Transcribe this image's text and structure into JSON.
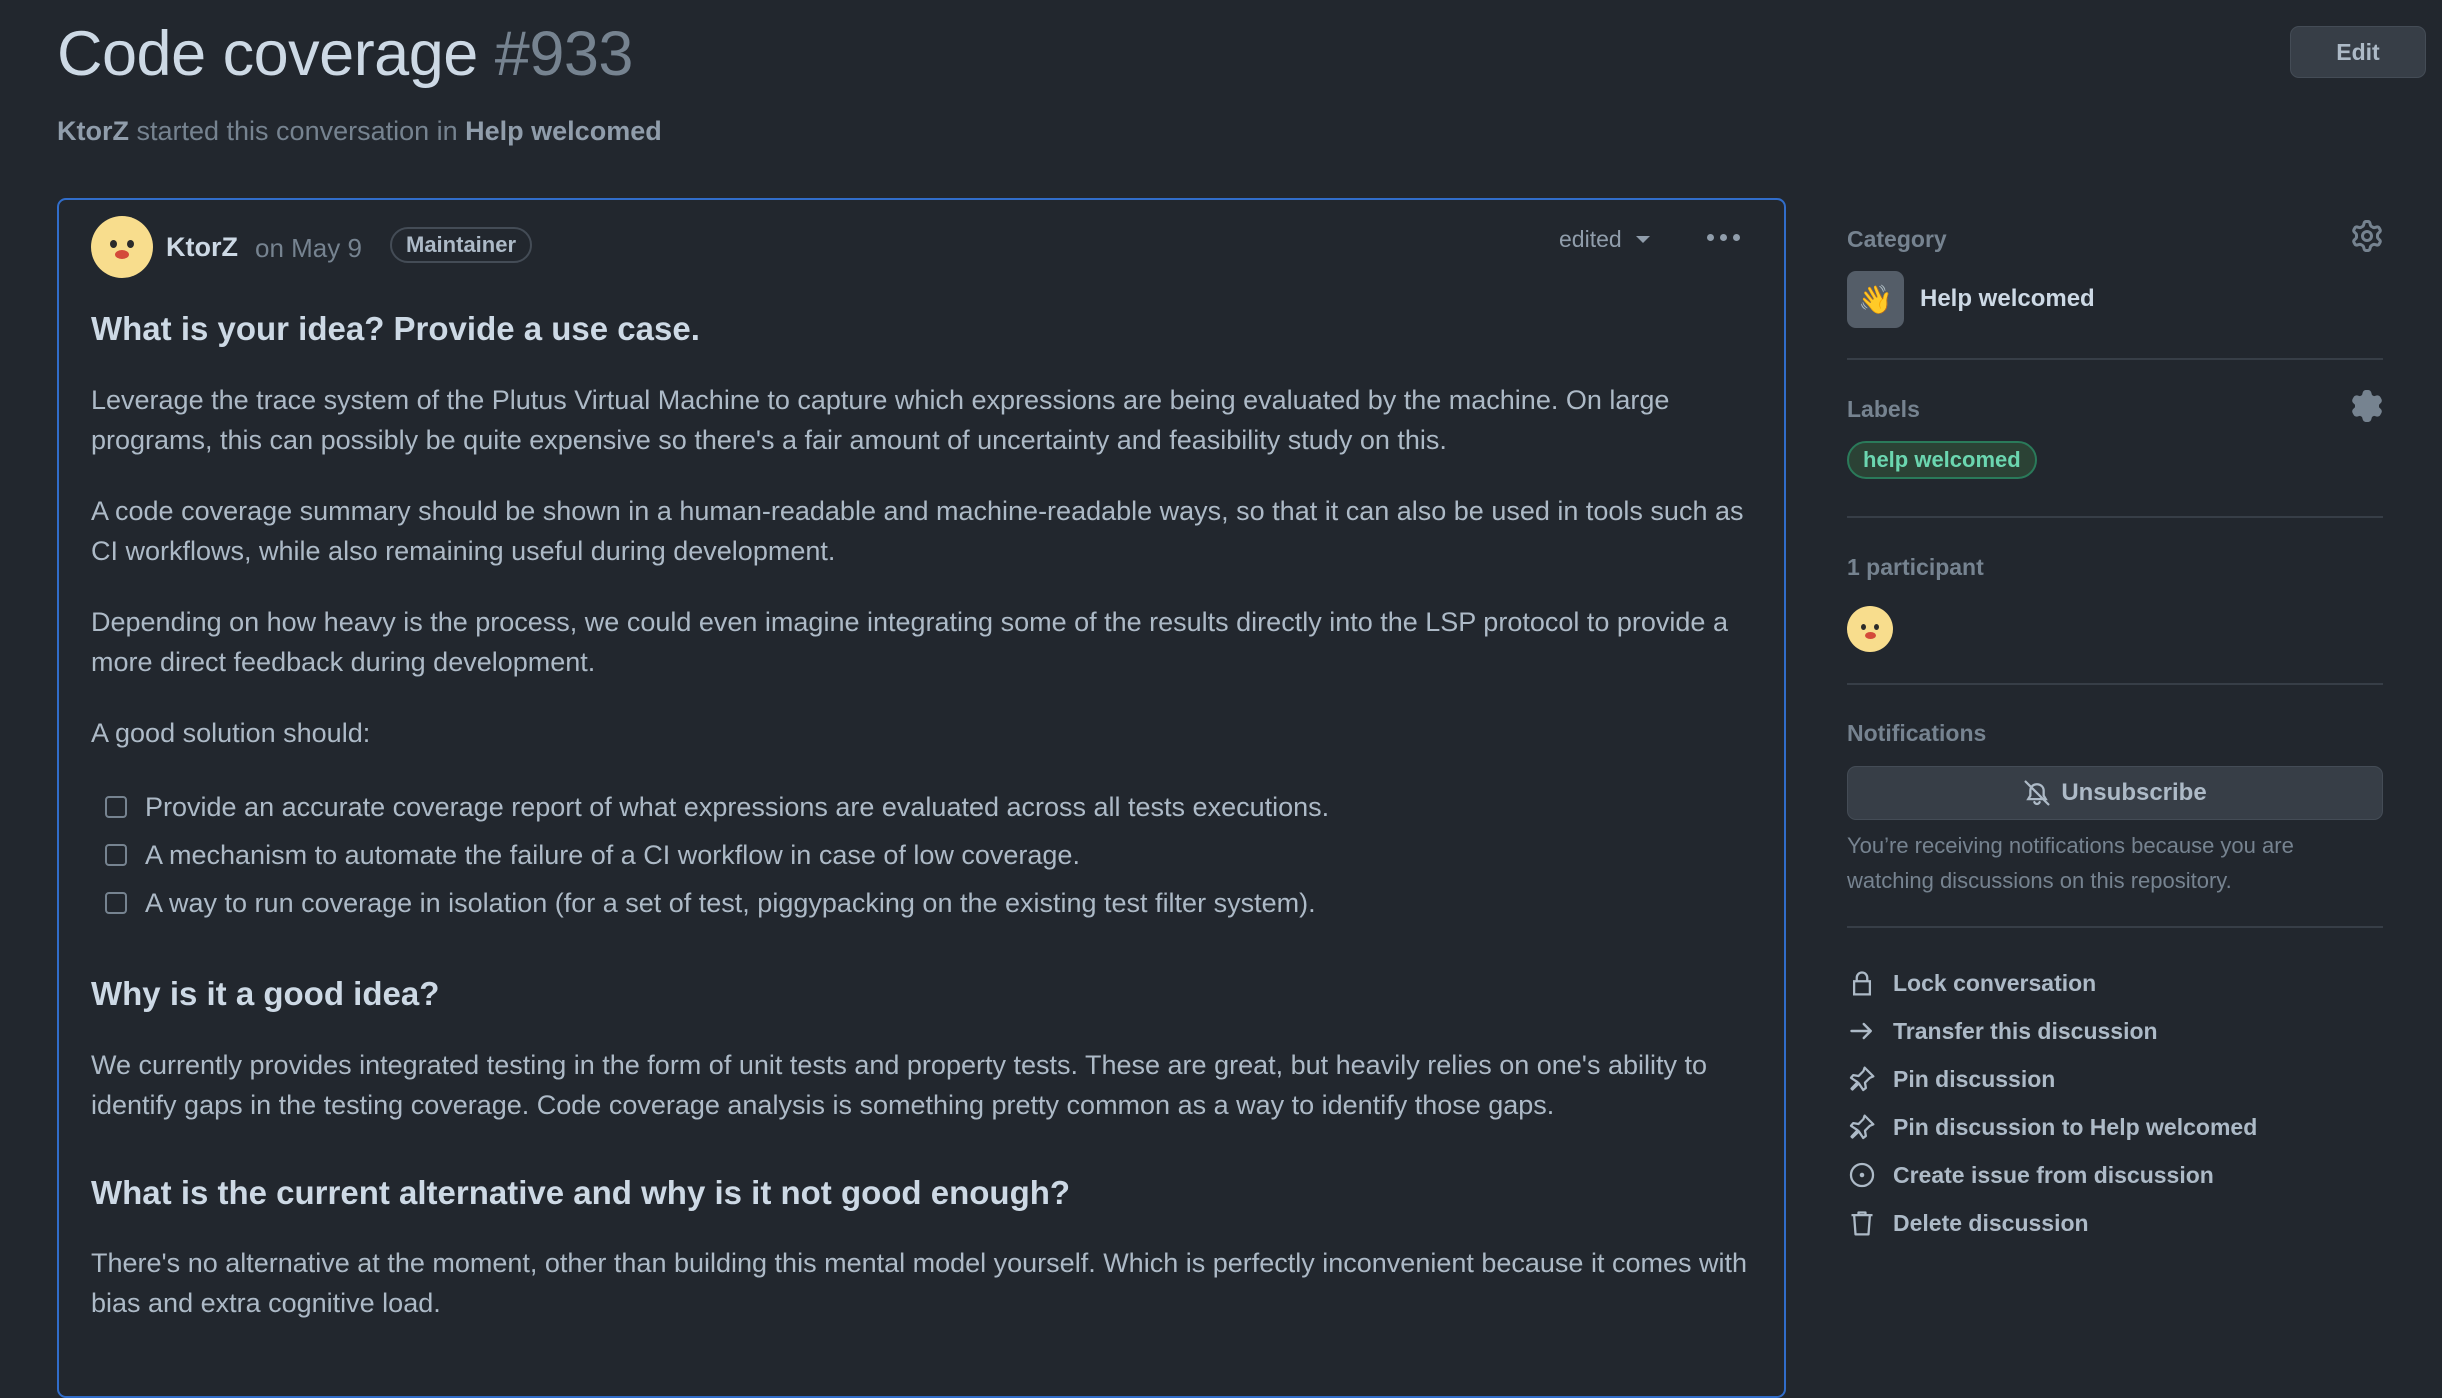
{
  "header": {
    "title": "Code coverage",
    "number": "#933",
    "subtitle": {
      "author": "KtorZ",
      "middle": " started this conversation in ",
      "category": "Help welcomed"
    },
    "edit_label": "Edit"
  },
  "post": {
    "author": "KtorZ",
    "date": "on May 9",
    "badge": "Maintainer",
    "edited_label": "edited",
    "sections": {
      "idea_heading": "What is your idea? Provide a use case.",
      "p1": "Leverage the trace system of the Plutus Virtual Machine to capture which expressions are being evaluated by the machine. On large programs, this can possibly be quite expensive so there's a fair amount of uncertainty and feasibility study on this.",
      "p2": "A code coverage summary should be shown in a human-readable and machine-readable ways, so that it can also be used in tools such as CI workflows, while also remaining useful during development.",
      "p3": "Depending on how heavy is the process, we could even imagine integrating some of the results directly into the LSP protocol to provide a more direct feedback during development.",
      "p4": "A good solution should:",
      "tasks": [
        "Provide an accurate coverage report of what expressions are evaluated across all tests executions.",
        "A mechanism to automate the failure of a CI workflow in case of low coverage.",
        "A way to run coverage in isolation (for a set of test, piggypacking on the existing test filter system)."
      ],
      "why_heading": "Why is it a good idea?",
      "p5": "We currently provides integrated testing in the form of unit tests and property tests. These are great, but heavily relies on one's ability to identify gaps in the testing coverage. Code coverage analysis is something pretty common as a way to identify those gaps.",
      "alt_heading": "What is the current alternative and why is it not good enough?",
      "p6": "There's no alternative at the moment, other than building this mental model yourself. Which is perfectly inconvenient because it comes with bias and extra cognitive load."
    }
  },
  "sidebar": {
    "category_heading": "Category",
    "category_emoji": "👋",
    "category_name": "Help welcomed",
    "labels_heading": "Labels",
    "label": "help welcomed",
    "participants_heading": "1 participant",
    "notifications_heading": "Notifications",
    "unsubscribe_label": "Unsubscribe",
    "notifications_note": "You’re receiving notifications because you are watching discussions on this repository.",
    "actions": [
      {
        "label": "Lock conversation",
        "icon": "lock-icon"
      },
      {
        "label": "Transfer this discussion",
        "icon": "arrow-right-icon"
      },
      {
        "label": "Pin discussion",
        "icon": "pin-icon"
      },
      {
        "label": "Pin discussion to Help welcomed",
        "icon": "pin-icon"
      },
      {
        "label": "Create issue from discussion",
        "icon": "issue-opened-icon"
      },
      {
        "label": "Delete discussion",
        "icon": "trash-icon"
      }
    ]
  },
  "colors": {
    "background": "#22272e",
    "accent_border": "#316dca",
    "label_green": "#6bd6b0"
  }
}
